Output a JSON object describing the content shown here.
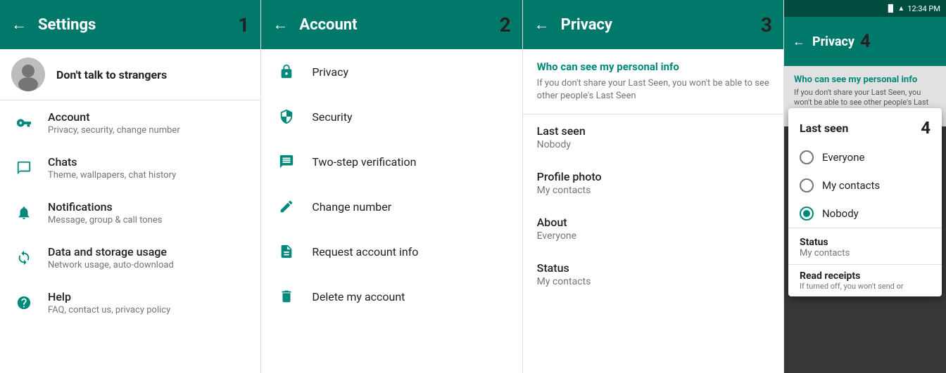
{
  "panels": {
    "settings": {
      "header": {
        "back_arrow": "←",
        "title": "Settings",
        "number": "1"
      },
      "profile": {
        "name": "Don't talk to strangers",
        "avatar_label": "user avatar"
      },
      "items": [
        {
          "id": "account",
          "title": "Account",
          "subtitle": "Privacy, security, change number",
          "icon": "key"
        },
        {
          "id": "chats",
          "title": "Chats",
          "subtitle": "Theme, wallpapers, chat history",
          "icon": "chat"
        },
        {
          "id": "notifications",
          "title": "Notifications",
          "subtitle": "Message, group & call tones",
          "icon": "bell"
        },
        {
          "id": "data",
          "title": "Data and storage usage",
          "subtitle": "Network usage, auto-download",
          "icon": "refresh"
        },
        {
          "id": "help",
          "title": "Help",
          "subtitle": "FAQ, contact us, privacy policy",
          "icon": "help"
        }
      ]
    },
    "account": {
      "header": {
        "back_arrow": "←",
        "title": "Account",
        "number": "2"
      },
      "items": [
        {
          "id": "privacy",
          "label": "Privacy",
          "icon": "lock"
        },
        {
          "id": "security",
          "label": "Security",
          "icon": "shield"
        },
        {
          "id": "two-step",
          "label": "Two-step verification",
          "icon": "dots"
        },
        {
          "id": "change-number",
          "label": "Change number",
          "icon": "doc-edit"
        },
        {
          "id": "request-info",
          "label": "Request account info",
          "icon": "doc"
        },
        {
          "id": "delete",
          "label": "Delete my account",
          "icon": "trash"
        }
      ]
    },
    "privacy": {
      "header": {
        "back_arrow": "←",
        "title": "Privacy",
        "number": "3"
      },
      "info": {
        "title": "Who can see my personal info",
        "text": "If you don't share your Last Seen, you won't be able to see other people's Last Seen"
      },
      "items": [
        {
          "id": "last-seen",
          "label": "Last seen",
          "value": "Nobody"
        },
        {
          "id": "profile-photo",
          "label": "Profile photo",
          "value": "My contacts"
        },
        {
          "id": "about",
          "label": "About",
          "value": "Everyone"
        },
        {
          "id": "status",
          "label": "Status",
          "value": "My contacts"
        }
      ]
    },
    "dialog": {
      "status_bar": {
        "time": "12:34 PM",
        "icons": "📶🔋"
      },
      "header": {
        "back_arrow": "←",
        "title": "Privacy",
        "number": "4"
      },
      "bg_info": {
        "title": "Who can see my personal info",
        "text": "If you don't share your Last Seen, you won't be able to see other people's Last Seen"
      },
      "dialog_box": {
        "title": "Last seen",
        "options": [
          {
            "id": "everyone",
            "label": "Everyone",
            "selected": false
          },
          {
            "id": "my-contacts",
            "label": "My contacts",
            "selected": false
          },
          {
            "id": "nobody",
            "label": "Nobody",
            "selected": true
          }
        ]
      },
      "status_section": {
        "title": "Status",
        "value": "My contacts"
      },
      "read_section": {
        "title": "Read receipts",
        "text": "If turned off, you won't send or"
      }
    }
  }
}
